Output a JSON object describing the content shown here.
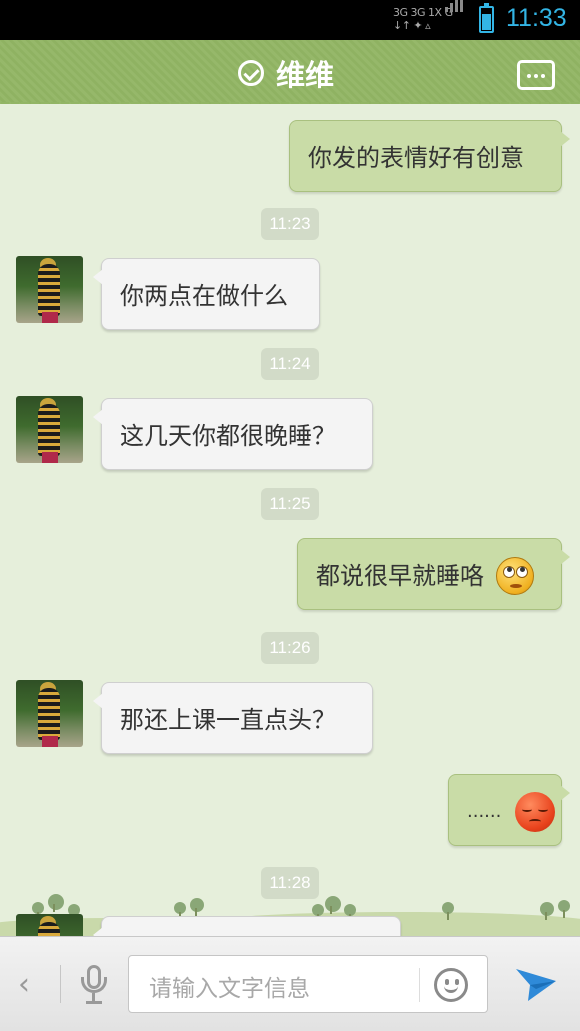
{
  "status_bar": {
    "network_top": "3G 3G 1X G",
    "network_bottom": "↓↑  ✦  ▵",
    "time": "11:33",
    "battery_level": 0.75,
    "accent": "#33b5e5"
  },
  "header": {
    "title": "维维",
    "status_icon": "check-circle-icon",
    "menu_icon": "more-icon",
    "background": "#92b565"
  },
  "conversation": {
    "messages": [
      {
        "type": "sent",
        "text": "你发的表情好有创意"
      },
      {
        "type": "time",
        "text": "11:23"
      },
      {
        "type": "received",
        "text": "你两点在做什么"
      },
      {
        "type": "time",
        "text": "11:24"
      },
      {
        "type": "received",
        "text": "这几天你都很晚睡？"
      },
      {
        "type": "time",
        "text": "11:25"
      },
      {
        "type": "sent",
        "text": "都说很早就睡咯",
        "emoji": "eye-roll-emoji"
      },
      {
        "type": "time",
        "text": "11:26"
      },
      {
        "type": "received",
        "text": "那还上课一直点头？"
      },
      {
        "type": "sent",
        "text": "......",
        "emoji": "sleepy-emoji"
      },
      {
        "type": "time",
        "text": "11:28"
      }
    ]
  },
  "input_bar": {
    "placeholder": "请输入文字信息",
    "back_icon": "chevron-left-icon",
    "voice_icon": "microphone-icon",
    "emoji_icon": "smiley-icon",
    "send_icon": "send-icon"
  }
}
